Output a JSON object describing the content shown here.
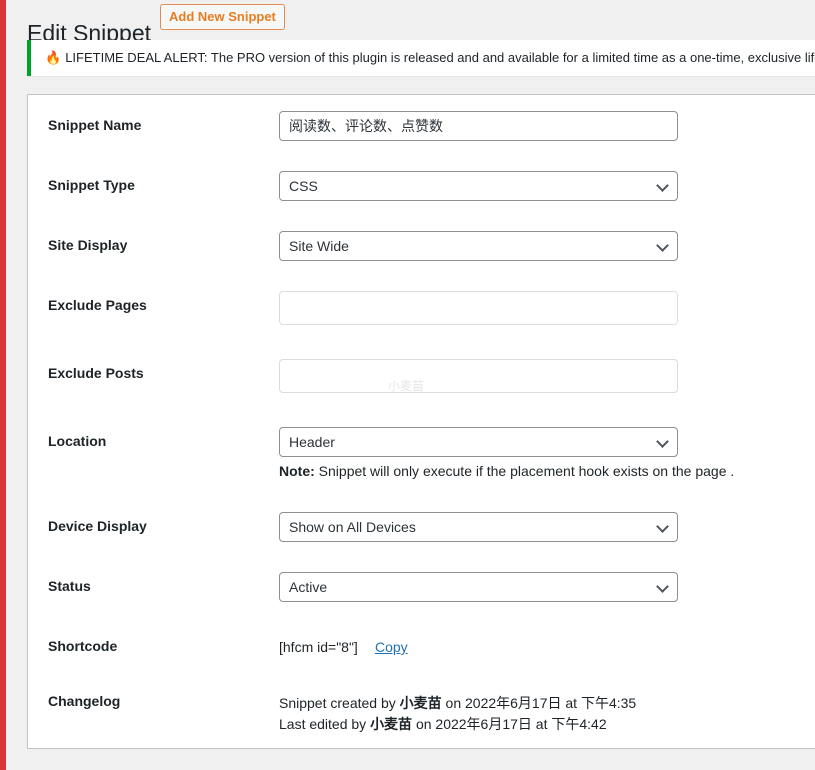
{
  "header": {
    "title": "Edit Snippet",
    "add_new_label": "Add New Snippet"
  },
  "notice": {
    "icon": "fire-icon",
    "text": "LIFETIME DEAL ALERT: The PRO version of this plugin is released and and available for a limited time as a one-time, exclusive lifetim"
  },
  "form": {
    "snippet_name": {
      "label": "Snippet Name",
      "value": "阅读数、评论数、点赞数"
    },
    "snippet_type": {
      "label": "Snippet Type",
      "value": "CSS"
    },
    "site_display": {
      "label": "Site Display",
      "value": "Site Wide"
    },
    "exclude_pages": {
      "label": "Exclude Pages",
      "value": ""
    },
    "exclude_posts": {
      "label": "Exclude Posts",
      "value": ""
    },
    "location": {
      "label": "Location",
      "value": "Header",
      "note_bold": "Note:",
      "note_text": " Snippet will only execute if the placement hook exists on the page ."
    },
    "device_display": {
      "label": "Device Display",
      "value": "Show on All Devices"
    },
    "status": {
      "label": "Status",
      "value": "Active"
    },
    "shortcode": {
      "label": "Shortcode",
      "value": "[hfcm id=\"8\"]",
      "copy_label": "Copy"
    },
    "changelog": {
      "label": "Changelog",
      "created_prefix": "Snippet created by ",
      "created_user": "小麦苗",
      "created_suffix": " on 2022年6月17日 at 下午4:35",
      "edited_prefix": "Last edited by ",
      "edited_user": "小麦苗",
      "edited_suffix": " on 2022年6月17日 at 下午4:42"
    }
  },
  "watermark": "小麦苗",
  "colors": {
    "accent_orange": "#e67e22",
    "notice_green": "#00a32a",
    "admin_red": "#d63638",
    "link_blue": "#2271b1"
  }
}
